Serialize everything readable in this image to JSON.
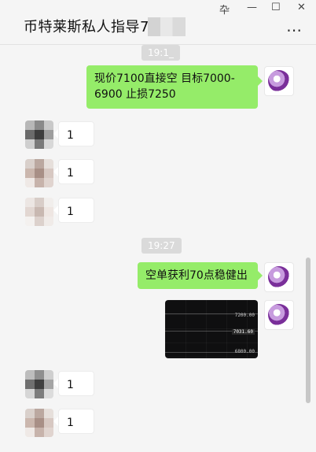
{
  "window": {
    "title": "币特莱斯私人指导7",
    "controls": [
      "卆",
      "—",
      "☐",
      "✕"
    ],
    "more_icon": "⋯"
  },
  "chat": {
    "messages": [
      {
        "type": "timestamp",
        "text": "19:1_"
      },
      {
        "type": "text",
        "from": "me",
        "text": "现价7100直接空 目标7000-6900 止损7250"
      },
      {
        "type": "text",
        "from": "other",
        "text": "1"
      },
      {
        "type": "text",
        "from": "other",
        "text": "1"
      },
      {
        "type": "text",
        "from": "other",
        "text": "1"
      },
      {
        "type": "timestamp",
        "text": "19:27"
      },
      {
        "type": "text",
        "from": "me",
        "text": "空单获利70点稳健出"
      },
      {
        "type": "image",
        "from": "me",
        "prices": [
          "7200.00",
          "7031.60",
          "6800.00"
        ]
      },
      {
        "type": "text",
        "from": "other",
        "text": "1"
      },
      {
        "type": "text",
        "from": "other",
        "text": "1"
      }
    ]
  },
  "colors": {
    "accent_green": "#95ec69",
    "background": "#f5f5f5",
    "bubble_white": "#ffffff"
  }
}
